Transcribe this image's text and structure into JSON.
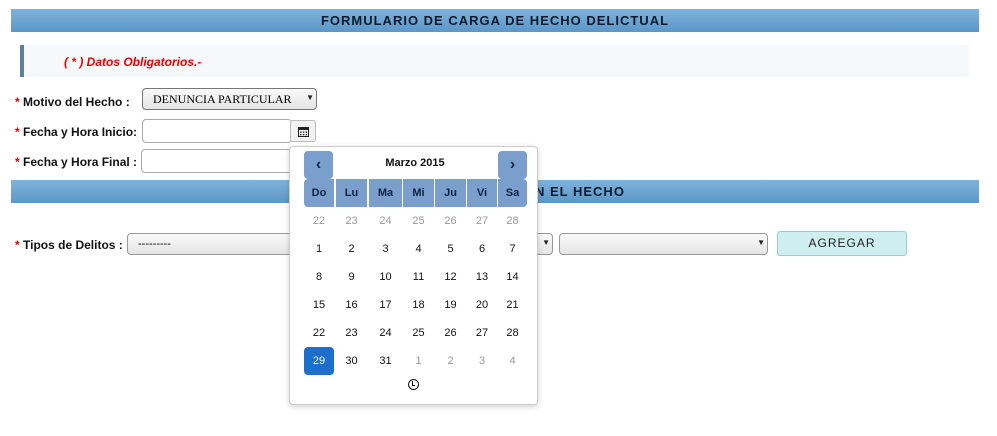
{
  "form": {
    "title": "FORMULARIO DE CARGA DE HECHO DELICTUAL",
    "required_note": "( * ) Datos Obligatorios.-",
    "motivo": {
      "label": "Motivo del Hecho :",
      "value": "DENUNCIA PARTICULAR"
    },
    "fecha_inicio": {
      "label": "Fecha y Hora Inicio:",
      "value": ""
    },
    "fecha_final": {
      "label": "Fecha y Hora Final :",
      "value": ""
    },
    "section_title": "N EL HECHO",
    "tipos": {
      "label": "Tipos de Delitos :",
      "value": "---------",
      "second_value": ""
    },
    "add_button": "AGREGAR",
    "required_star": "*"
  },
  "datepicker": {
    "month_label": "Marzo 2015",
    "prev": "‹",
    "next": "›",
    "dow": [
      "Do",
      "Lu",
      "Ma",
      "Mi",
      "Ju",
      "Vi",
      "Sa"
    ],
    "weeks": [
      [
        "22",
        "23",
        "24",
        "25",
        "26",
        "27",
        "28"
      ],
      [
        "1",
        "2",
        "3",
        "4",
        "5",
        "6",
        "7"
      ],
      [
        "8",
        "9",
        "10",
        "11",
        "12",
        "13",
        "14"
      ],
      [
        "15",
        "16",
        "17",
        "18",
        "19",
        "20",
        "21"
      ],
      [
        "22",
        "23",
        "24",
        "25",
        "26",
        "27",
        "28"
      ],
      [
        "29",
        "30",
        "31",
        "1",
        "2",
        "3",
        "4"
      ]
    ],
    "muted": [
      [
        0,
        0
      ],
      [
        0,
        1
      ],
      [
        0,
        2
      ],
      [
        0,
        3
      ],
      [
        0,
        4
      ],
      [
        0,
        5
      ],
      [
        0,
        6
      ],
      [
        5,
        3
      ],
      [
        5,
        4
      ],
      [
        5,
        5
      ],
      [
        5,
        6
      ]
    ],
    "selected": [
      5,
      0
    ],
    "selected_color": "#1d6fce",
    "header_color": "#7a9fcd",
    "icons": {
      "calendar": "calendar-icon",
      "clock": "clock-icon"
    }
  }
}
